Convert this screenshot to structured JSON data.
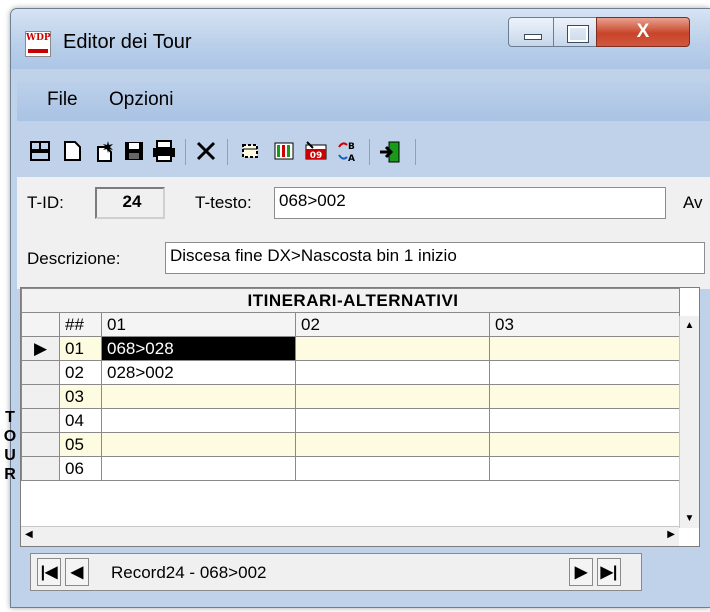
{
  "window": {
    "title": "Editor dei Tour",
    "app_icon_text": "WDP",
    "close_glyph": "X"
  },
  "menu": {
    "file": "File",
    "options": "Opzioni"
  },
  "toolbar": {
    "icons": [
      "grid-view-icon",
      "new-document-icon",
      "new-wizard-icon",
      "save-icon",
      "print-icon",
      "delete-icon",
      "select-area-icon",
      "columns-icon",
      "date-icon",
      "sort-ab-icon",
      "exit-icon"
    ]
  },
  "fields": {
    "tid_label": "T-ID:",
    "tid_value": "24",
    "ttesto_label": "T-testo:",
    "ttesto_value": "068>002",
    "cut_label": "Av",
    "descr_label": "Descrizione:",
    "descr_value": "Discesa fine DX>Nascosta bin 1 inizio"
  },
  "grid": {
    "caption": "ITINERARI-ALTERNATIVI",
    "side_label": "TOUR",
    "headers": [
      "##",
      "01",
      "02",
      "03"
    ],
    "rows": [
      {
        "num": "01",
        "c1": "068>028",
        "c2": "",
        "c3": ""
      },
      {
        "num": "02",
        "c1": "028>002",
        "c2": "",
        "c3": ""
      },
      {
        "num": "03",
        "c1": "",
        "c2": "",
        "c3": ""
      },
      {
        "num": "04",
        "c1": "",
        "c2": "",
        "c3": ""
      },
      {
        "num": "05",
        "c1": "",
        "c2": "",
        "c3": ""
      },
      {
        "num": "06",
        "c1": "",
        "c2": "",
        "c3": ""
      }
    ]
  },
  "navigator": {
    "record_text": "Record24 - 068>002"
  },
  "colors": {
    "row_highlight": "#fdfbe0",
    "selected_cell": "#000000",
    "window_frame": "#bfd2ea"
  }
}
